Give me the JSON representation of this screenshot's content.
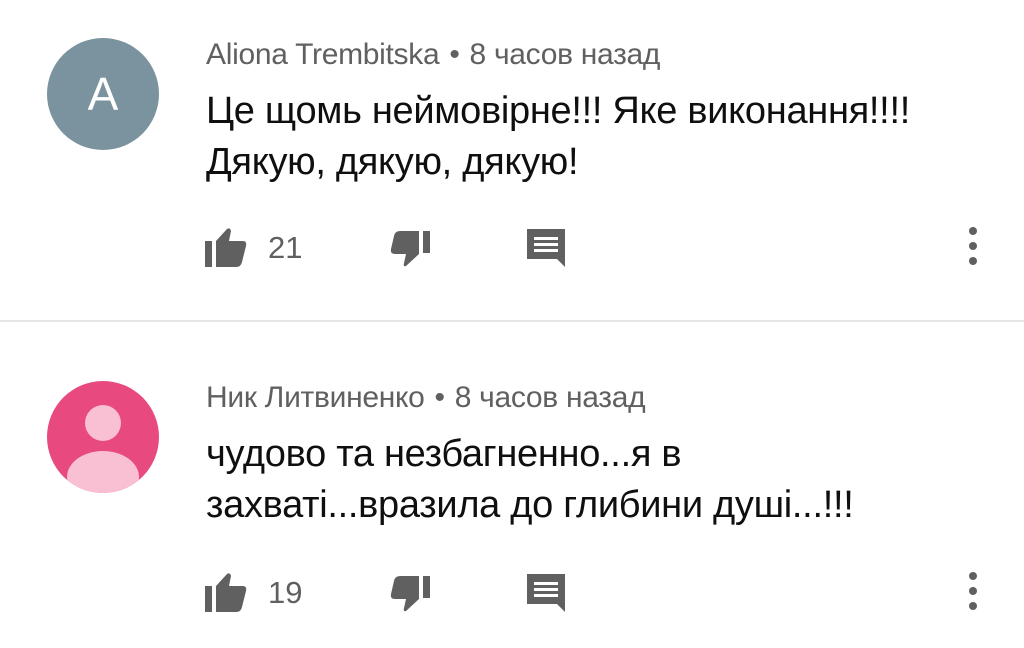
{
  "comments": [
    {
      "author": "Aliona Trembitska",
      "separator": "•",
      "time": "8 часов назад",
      "avatar_letter": "A",
      "avatar_color": "#7a939e",
      "text_lines": [
        "Це щомь неймовірне!!! Яке виконання!!!!",
        "Дякую, дякую, дякую!"
      ],
      "likes": "21"
    },
    {
      "author": "Ник Литвиненко",
      "separator": "•",
      "time": "8 часов назад",
      "avatar_icon": "person-icon",
      "avatar_color": "#e8497e",
      "text_lines": [
        "чудово та незбагненно...я в",
        "захваті...вразила до глибини душі...!!!"
      ],
      "likes": "19"
    }
  ],
  "icons": {
    "like": "thumbs-up-icon",
    "dislike": "thumbs-down-icon",
    "reply": "reply-icon",
    "more": "more-vertical-icon"
  },
  "colors": {
    "icon": "#606060",
    "meta_text": "#606060",
    "body_text": "#0f0f0f",
    "divider": "#e6e6e6"
  }
}
